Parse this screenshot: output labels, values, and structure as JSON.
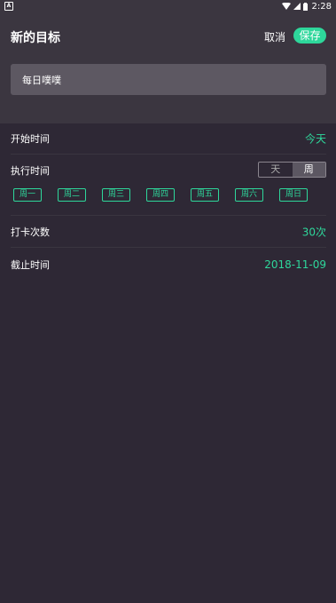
{
  "status_bar": {
    "time": "2:28",
    "notification": "A"
  },
  "header": {
    "title": "新的目标",
    "cancel_label": "取消",
    "save_label": "保存"
  },
  "goal_input": {
    "value": "每日噗噗"
  },
  "start_time": {
    "label": "开始时间",
    "value": "今天"
  },
  "exec_time": {
    "label": "执行时间",
    "toggle_options": [
      "天",
      "周"
    ],
    "selected": "周",
    "days": [
      "周一",
      "周二",
      "周三",
      "周四",
      "周五",
      "周六",
      "周日"
    ]
  },
  "checkin_count": {
    "label": "打卡次数",
    "value": "30次"
  },
  "deadline": {
    "label": "截止时间",
    "value": "2018-11-09"
  },
  "colors": {
    "accent": "#2ed79b",
    "header_bg": "#3b3640",
    "body_bg": "#2e2835"
  }
}
